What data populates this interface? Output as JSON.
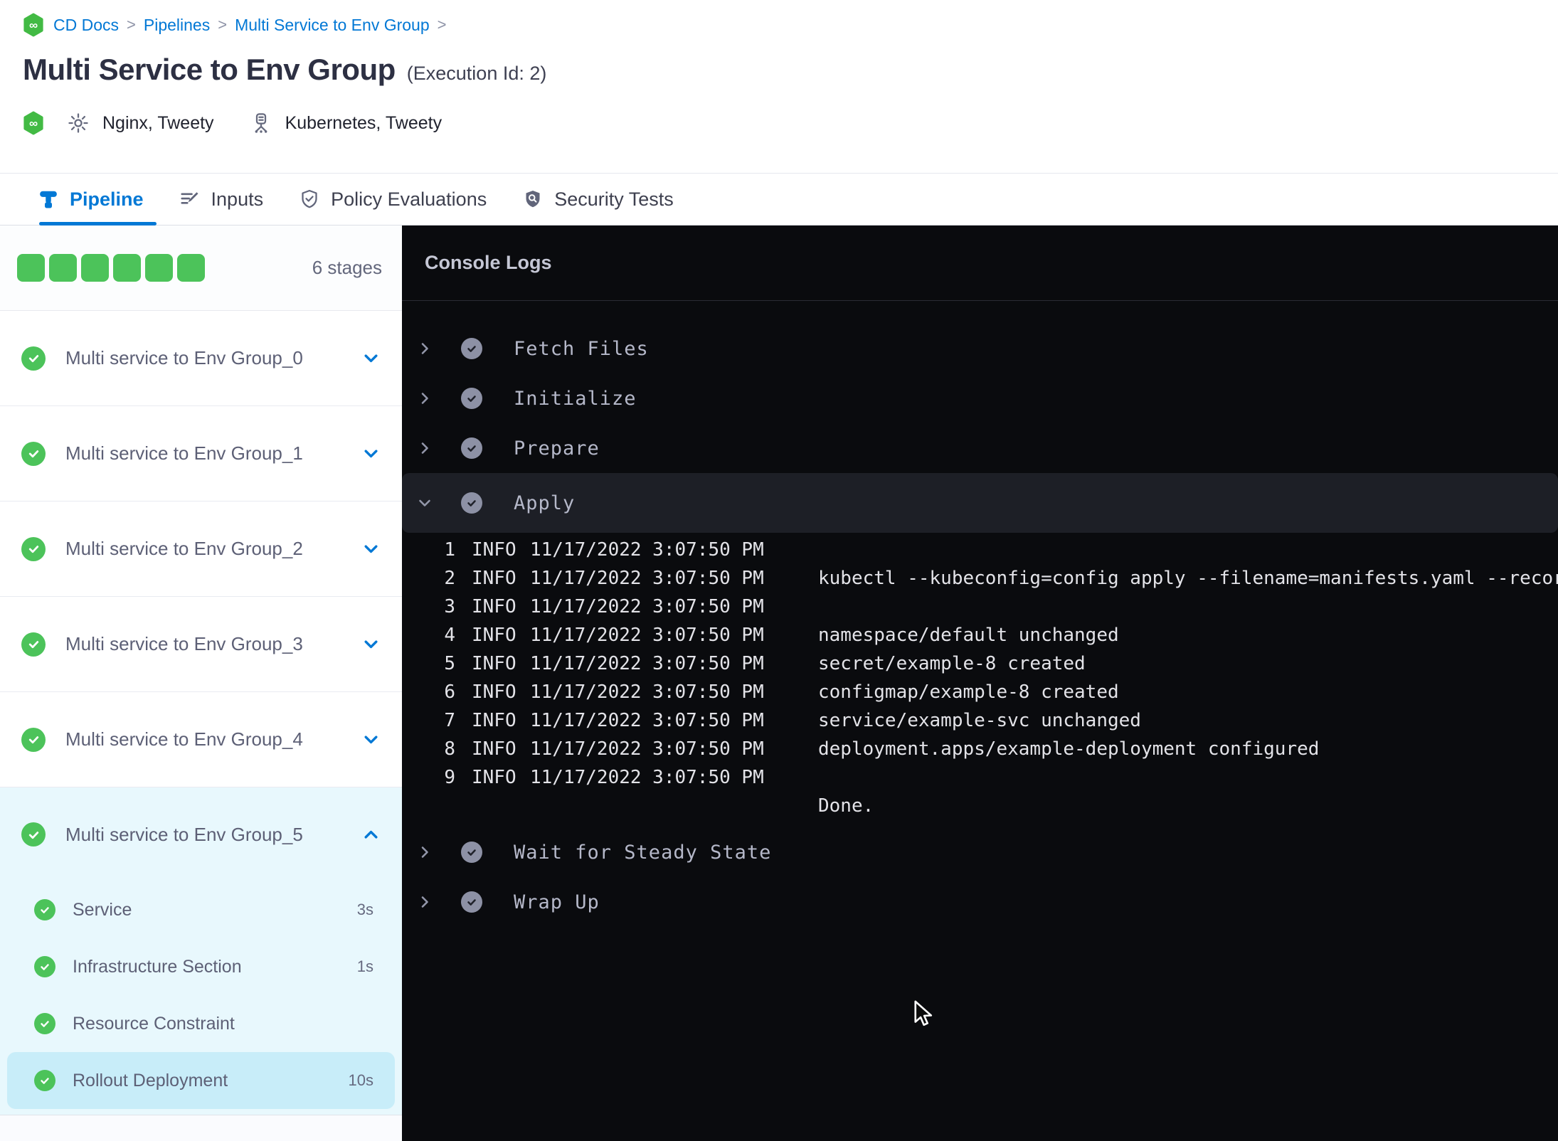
{
  "colors": {
    "primary_blue": "#0278d5",
    "success_green": "#4cc35a",
    "console_bg": "#0a0b0e",
    "selected_step_bg": "#c8edf9",
    "expanded_stage_bg": "#e8f8fd"
  },
  "icons": {
    "infinity": "∞"
  },
  "breadcrumb": {
    "separator": ">",
    "items": [
      "CD Docs",
      "Pipelines",
      "Multi Service to Env Group"
    ]
  },
  "header": {
    "title": "Multi Service to Env Group",
    "execution_id": "(Execution Id: 2)",
    "service": "Nginx, Tweety",
    "infrastructure": "Kubernetes, Tweety"
  },
  "tabs": {
    "pipeline": "Pipeline",
    "inputs": "Inputs",
    "policy": "Policy Evaluations",
    "security": "Security Tests"
  },
  "sidebar": {
    "stages_count": "6 stages",
    "stages": [
      {
        "label": "Multi service to Env Group_0"
      },
      {
        "label": "Multi service to Env Group_1"
      },
      {
        "label": "Multi service to Env Group_2"
      },
      {
        "label": "Multi service to Env Group_3"
      },
      {
        "label": "Multi service to Env Group_4"
      },
      {
        "label": "Multi service to Env Group_5",
        "steps": [
          {
            "label": "Service",
            "duration": "3s"
          },
          {
            "label": "Infrastructure Section",
            "duration": "1s"
          },
          {
            "label": "Resource Constraint",
            "duration": ""
          },
          {
            "label": "Rollout Deployment",
            "duration": "10s"
          }
        ]
      }
    ]
  },
  "console": {
    "title": "Console Logs",
    "steps": {
      "fetch": "Fetch Files",
      "initialize": "Initialize",
      "prepare": "Prepare",
      "apply": "Apply",
      "wait": "Wait for Steady State",
      "wrap": "Wrap Up"
    },
    "logs": [
      {
        "num": "1",
        "level": "INFO",
        "time": "11/17/2022 3:07:50 PM",
        "message": ""
      },
      {
        "num": "2",
        "level": "INFO",
        "time": "11/17/2022 3:07:50 PM",
        "message": "kubectl --kubeconfig=config apply --filename=manifests.yaml --record"
      },
      {
        "num": "3",
        "level": "INFO",
        "time": "11/17/2022 3:07:50 PM",
        "message": ""
      },
      {
        "num": "4",
        "level": "INFO",
        "time": "11/17/2022 3:07:50 PM",
        "message": "namespace/default unchanged"
      },
      {
        "num": "5",
        "level": "INFO",
        "time": "11/17/2022 3:07:50 PM",
        "message": "secret/example-8 created"
      },
      {
        "num": "6",
        "level": "INFO",
        "time": "11/17/2022 3:07:50 PM",
        "message": "configmap/example-8 created"
      },
      {
        "num": "7",
        "level": "INFO",
        "time": "11/17/2022 3:07:50 PM",
        "message": "service/example-svc unchanged"
      },
      {
        "num": "8",
        "level": "INFO",
        "time": "11/17/2022 3:07:50 PM",
        "message": "deployment.apps/example-deployment configured"
      },
      {
        "num": "9",
        "level": "INFO",
        "time": "11/17/2022 3:07:50 PM",
        "message": ""
      },
      {
        "num": "",
        "level": "",
        "time": "",
        "message": "Done."
      }
    ]
  }
}
